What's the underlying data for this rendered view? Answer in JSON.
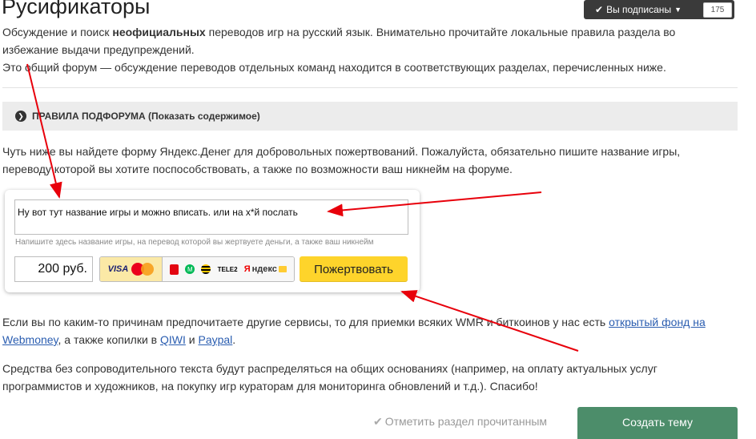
{
  "header": {
    "title": "Русификаторы",
    "subscribed_label": "Вы подписаны",
    "subscriber_count": "175"
  },
  "description": {
    "line1_before": "Обсуждение и поиск ",
    "line1_bold": "неофициальных",
    "line1_after": " переводов игр на русский язык. Внимательно прочитайте локальные правила раздела во избежание выдачи предупреждений.",
    "line2": "Это общий форум — обсуждение переводов отдельных команд находится в соответствующих разделах, перечисленных ниже."
  },
  "rules": {
    "label": "ПРАВИЛА ПОДФОРУМА (Показать содержимое)"
  },
  "donate_intro": "Чуть ниже вы найдете форму Яндекс.Денег для добровольных пожертвований. Пожалуйста, обязательно пишите название игры, переводу которой вы хотите поспособствовать, а также по возможности ваш никнейм на форуме.",
  "donation_form": {
    "comment_value": "Ну вот тут название игры и можно вписать. или на х*й послать",
    "hint": "Напишите здесь название игры, на перевод которой вы жертвуете деньги, а также ваш никнейм",
    "amount": "200 руб.",
    "card_visa": "VISA",
    "tele2": "TELE2",
    "yandex_logo_r": "Я",
    "yandex_logo_rest": "ндекс",
    "donate_label": "Пожертвовать"
  },
  "other_services": {
    "text_before": "Если вы по каким-то причинам предпочитаете другие сервисы, то для приемки всяких WMR и биткоинов у нас есть ",
    "link_fund": "открытый фонд на Webmoney",
    "text_middle": ", а также копилки в ",
    "link_qiwi": "QIWI",
    "text_and": " и ",
    "link_paypal": "Paypal",
    "text_end": "."
  },
  "note": "Средства без сопроводительного текста будут распределяться на общих основаниях (например, на оплату актуальных услуг программистов и художников, на покупку игр кураторам для мониторинга обновлений и т.д.). Спасибо!",
  "footer": {
    "mark_read_label": "Отметить раздел прочитанным",
    "create_topic_label": "Создать тему"
  },
  "colors": {
    "annotation": "#e8000b",
    "accent_green": "#4c8d6a",
    "donate_yellow": "#fed42b"
  }
}
